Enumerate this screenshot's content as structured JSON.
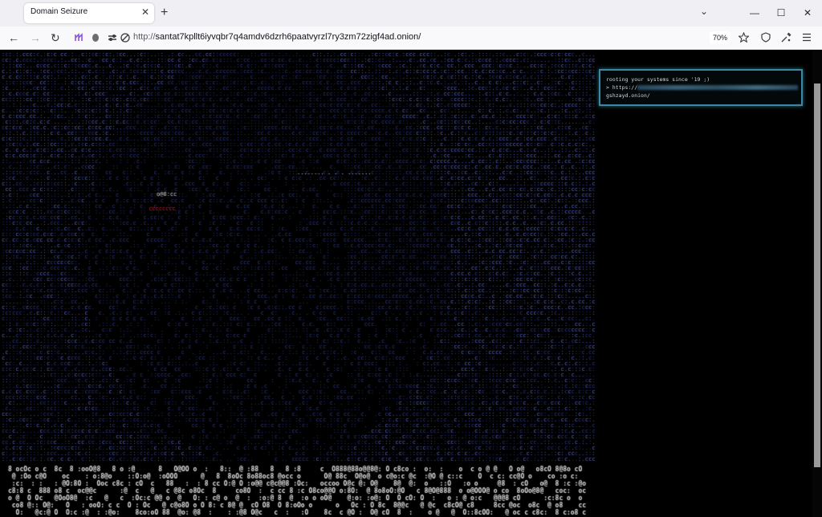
{
  "browser": {
    "tab_title": "Domain Seizure",
    "tab_close_glyph": "✕",
    "new_tab_glyph": "+",
    "tab_list_glyph": "⌄",
    "window_controls": {
      "minimize": "—",
      "maximize": "☐",
      "close": "✕"
    },
    "nav": {
      "back": "←",
      "forward": "→",
      "reload": "↻"
    },
    "url_scheme": "http://",
    "url_host": "santat7kpllt6iyvqbr7q4amdv6dzrh6paatvyrzl7ry3zm72zigf4ad.onion/",
    "zoom": "70%",
    "icons": [
      "extension-icon",
      "tracking-protection-icon",
      "permissions-icon",
      "bookmark-star-icon",
      "shield-icon",
      "extensions-puzzle-icon",
      "menu-icon"
    ]
  },
  "page": {
    "terminal": {
      "line1": "rooting your systems since '19 ;)",
      "line2_prefix": "> https://",
      "line3": "gshzayd.onion/"
    },
    "art_colors": {
      "background": "#000000",
      "ascii_blue": "#3d4aa6",
      "ascii_white": "#e0e0e0",
      "ascii_red": "#c02020",
      "border": "#3b88a6"
    },
    "banner_glyphs": "@8Oo:c"
  }
}
